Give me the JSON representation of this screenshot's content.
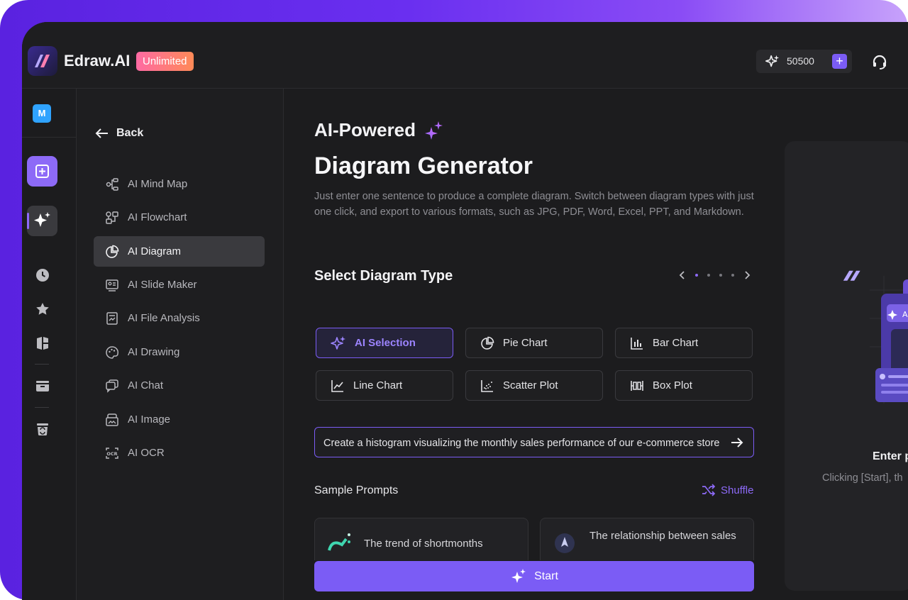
{
  "app": {
    "name": "Edraw.AI",
    "plan_badge": "Unlimited",
    "credits": "50500",
    "credits_add": "+"
  },
  "rail": {
    "avatar_initial": "M"
  },
  "sidebar": {
    "back_label": "Back",
    "items": [
      {
        "label": "AI Mind Map",
        "icon": "mind-map-icon"
      },
      {
        "label": "AI Flowchart",
        "icon": "flowchart-icon"
      },
      {
        "label": "AI Diagram",
        "icon": "pie-chart-icon",
        "active": true
      },
      {
        "label": "AI Slide Maker",
        "icon": "slide-icon"
      },
      {
        "label": "AI File Analysis",
        "icon": "file-analysis-icon"
      },
      {
        "label": "AI Drawing",
        "icon": "palette-icon"
      },
      {
        "label": "AI Chat",
        "icon": "chat-icon"
      },
      {
        "label": "AI Image",
        "icon": "image-icon"
      },
      {
        "label": "AI OCR",
        "icon": "ocr-icon"
      }
    ]
  },
  "main": {
    "heading_small": "AI-Powered",
    "heading_large": "Diagram Generator",
    "description": "Just enter one sentence to produce a complete diagram. Switch between diagram types with just one click, and export to various formats, such as JPG, PDF, Word, Excel, PPT, and Markdown.",
    "select_title": "Select Diagram Type",
    "diagram_types": [
      {
        "label": "AI Selection",
        "selected": true
      },
      {
        "label": "Pie Chart"
      },
      {
        "label": "Bar Chart"
      },
      {
        "label": "Line Chart"
      },
      {
        "label": "Scatter Plot"
      },
      {
        "label": "Box Plot"
      }
    ],
    "prompt_value": "Create a histogram visualizing the monthly sales performance of our e-commerce store",
    "sample_title": "Sample Prompts",
    "shuffle_label": "Shuffle",
    "samples": [
      {
        "text": "The trend of shortmonths"
      },
      {
        "text": "The relationship between sales"
      }
    ],
    "start_label": "Start"
  },
  "preview": {
    "heading": "Enter p",
    "text": "Clicking [Start], th"
  },
  "colors": {
    "accent": "#7b5cf5",
    "window_bg": "#1c1c1e"
  }
}
